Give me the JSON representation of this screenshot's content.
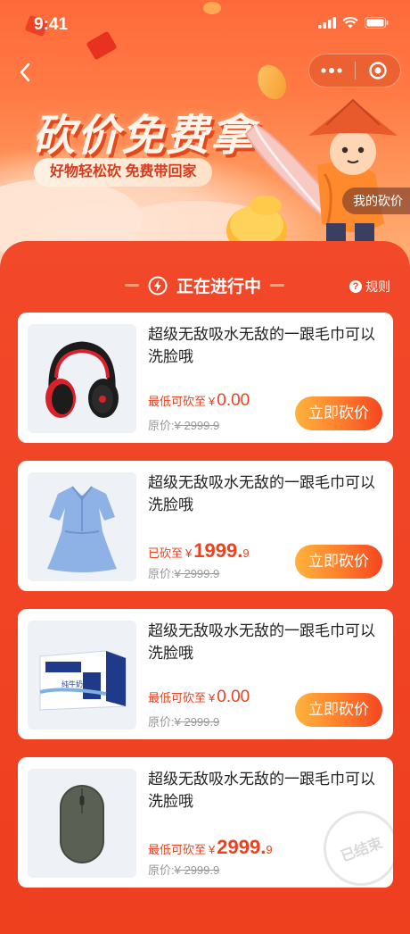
{
  "status": {
    "time": "9:41"
  },
  "hero": {
    "title": "砍价免费拿",
    "subtitle": "好物轻松砍  免费带回家",
    "my_bargain": "我的砍价"
  },
  "section": {
    "title": "正在进行中",
    "rules": "规则"
  },
  "products": [
    {
      "title": "超级无敌吸水无敌的一跟毛巾可以洗脸哦",
      "price_label": "最低可砍至",
      "currency": "¥",
      "price": "0.00",
      "price_decimal": "",
      "orig_label": "原价:",
      "orig_price": "¥ 2999.9",
      "button": "立即砍价",
      "image": "headphones"
    },
    {
      "title": "超级无敌吸水无敌的一跟毛巾可以洗脸哦",
      "price_label": "已砍至",
      "currency": "¥",
      "price": "1999.",
      "price_decimal": "9",
      "orig_label": "原价:",
      "orig_price": "¥ 2999.9",
      "button": "立即砍价",
      "image": "dress"
    },
    {
      "title": "超级无敌吸水无敌的一跟毛巾可以洗脸哦",
      "price_label": "最低可砍至",
      "currency": "¥",
      "price": "0.00",
      "price_decimal": "",
      "orig_label": "原价:",
      "orig_price": "¥ 2999.9",
      "button": "立即砍价",
      "image": "milk-box",
      "box_text": "纯牛奶"
    },
    {
      "title": "超级无敌吸水无敌的一跟毛巾可以洗脸哦",
      "price_label": "最低可砍至",
      "currency": "¥",
      "price": "2999.",
      "price_decimal": "9",
      "orig_label": "原价:",
      "orig_price": "¥ 2999.9",
      "image": "mouse",
      "stamp": "已结束"
    }
  ],
  "colors": {
    "primary": "#f0401e",
    "button_from": "#ffb33c",
    "button_to": "#f5461f"
  }
}
